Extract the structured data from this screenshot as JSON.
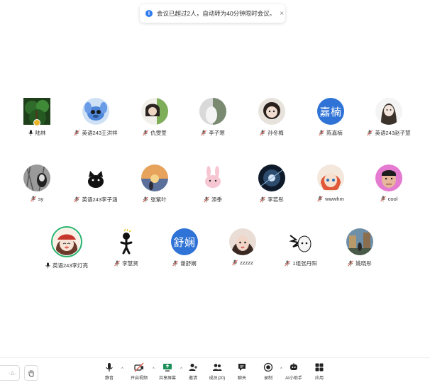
{
  "toast": {
    "message": "会议已超过2人，自动转为40分钟限时会议。",
    "close": "×"
  },
  "participants": [
    {
      "name": "陆林",
      "avatar": "forest",
      "mic": "green",
      "badge": true
    },
    {
      "name": "英语243王洪祥",
      "avatar": "stitch",
      "mic": "muted"
    },
    {
      "name": "仇雯萱",
      "avatar": "girl-green",
      "mic": "muted"
    },
    {
      "name": "李子寒",
      "avatar": "white-figure",
      "mic": "muted"
    },
    {
      "name": "孙冬梅",
      "avatar": "girl-dark",
      "mic": "muted"
    },
    {
      "name": "陈嘉楠",
      "avatar": "text",
      "text": "嘉楠",
      "mic": "muted"
    },
    {
      "name": "英语243赵子慧",
      "avatar": "girl-portrait",
      "mic": "muted"
    },
    {
      "name": "sy",
      "avatar": "bw-girl",
      "mic": "muted"
    },
    {
      "name": "英语243李子涵",
      "avatar": "black-cat",
      "mic": "muted"
    },
    {
      "name": "张紫叶",
      "avatar": "sunset",
      "mic": "muted"
    },
    {
      "name": "添季",
      "avatar": "pink-rabbit",
      "mic": "muted"
    },
    {
      "name": "李若彤",
      "avatar": "space",
      "mic": "muted"
    },
    {
      "name": "wwwhm",
      "avatar": "anime-red",
      "mic": "muted"
    },
    {
      "name": "cool",
      "avatar": "man-pink",
      "mic": "muted"
    },
    {
      "name": "英语243李灯亮",
      "avatar": "cartoon-girl",
      "mic": "green",
      "ring": true
    },
    {
      "name": "李慧贤",
      "avatar": "stick-figure",
      "mic": "muted"
    },
    {
      "name": "谢舒娴",
      "avatar": "text",
      "text": "舒娴",
      "mic": "muted"
    },
    {
      "name": "zzzzz",
      "avatar": "girl-closeup",
      "mic": "muted"
    },
    {
      "name": "1组张丹阳",
      "avatar": "manga",
      "mic": "muted"
    },
    {
      "name": "姚晓彤",
      "avatar": "street",
      "mic": "muted"
    }
  ],
  "toolbar": {
    "left_box": "·△..",
    "items": [
      {
        "label": "静音",
        "icon": "mic-icon"
      },
      {
        "label": "开启视频",
        "icon": "video-off-icon"
      },
      {
        "label": "共享屏幕",
        "icon": "share-screen-icon"
      },
      {
        "label": "邀请",
        "icon": "invite-icon"
      },
      {
        "label": "成员(20)",
        "icon": "members-icon"
      },
      {
        "label": "聊天",
        "icon": "chat-icon"
      },
      {
        "label": "录制",
        "icon": "record-icon"
      },
      {
        "label": "AI小助手",
        "icon": "ai-assistant-icon"
      },
      {
        "label": "应用",
        "icon": "apps-icon"
      }
    ]
  },
  "colors": {
    "accent": "#2f73d6",
    "active_green": "#27b36b",
    "muted_red": "#e25b4b"
  }
}
